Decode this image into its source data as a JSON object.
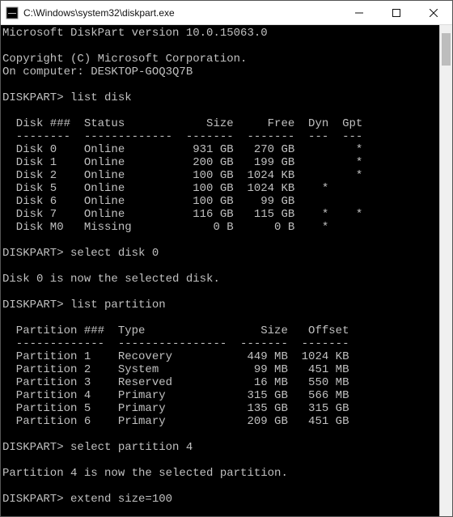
{
  "window": {
    "title": "C:\\Windows\\system32\\diskpart.exe"
  },
  "intro": {
    "version_line": "Microsoft DiskPart version 10.0.15063.0",
    "copyright_line": "Copyright (C) Microsoft Corporation.",
    "computer_line": "On computer: DESKTOP-GOQ3Q7B"
  },
  "prompt": "DISKPART>",
  "commands": {
    "cmd1": "list disk",
    "cmd2": "select disk 0",
    "cmd3": "list partition",
    "cmd4": "select partition 4",
    "cmd5": "extend size=100"
  },
  "messages": {
    "selected_disk": "Disk 0 is now the selected disk.",
    "selected_partition": "Partition 4 is now the selected partition."
  },
  "disk_table": {
    "header": {
      "col1": "Disk ###",
      "col2": "Status",
      "col3": "Size",
      "col4": "Free",
      "col5": "Dyn",
      "col6": "Gpt"
    },
    "rows": [
      {
        "name": "Disk 0",
        "status": "Online",
        "size": "931 GB",
        "free": "270 GB",
        "dyn": "",
        "gpt": "*"
      },
      {
        "name": "Disk 1",
        "status": "Online",
        "size": "200 GB",
        "free": "199 GB",
        "dyn": "",
        "gpt": "*"
      },
      {
        "name": "Disk 2",
        "status": "Online",
        "size": "100 GB",
        "free": "1024 KB",
        "dyn": "",
        "gpt": "*"
      },
      {
        "name": "Disk 5",
        "status": "Online",
        "size": "100 GB",
        "free": "1024 KB",
        "dyn": "*",
        "gpt": ""
      },
      {
        "name": "Disk 6",
        "status": "Online",
        "size": "100 GB",
        "free": "99 GB",
        "dyn": "",
        "gpt": ""
      },
      {
        "name": "Disk 7",
        "status": "Online",
        "size": "116 GB",
        "free": "115 GB",
        "dyn": "*",
        "gpt": "*"
      },
      {
        "name": "Disk M0",
        "status": "Missing",
        "size": "0 B",
        "free": "0 B",
        "dyn": "*",
        "gpt": ""
      }
    ]
  },
  "partition_table": {
    "header": {
      "col1": "Partition ###",
      "col2": "Type",
      "col3": "Size",
      "col4": "Offset"
    },
    "rows": [
      {
        "name": "Partition 1",
        "type": "Recovery",
        "size": "449 MB",
        "offset": "1024 KB"
      },
      {
        "name": "Partition 2",
        "type": "System",
        "size": "99 MB",
        "offset": "451 MB"
      },
      {
        "name": "Partition 3",
        "type": "Reserved",
        "size": "16 MB",
        "offset": "550 MB"
      },
      {
        "name": "Partition 4",
        "type": "Primary",
        "size": "315 GB",
        "offset": "566 MB"
      },
      {
        "name": "Partition 5",
        "type": "Primary",
        "size": "135 GB",
        "offset": "315 GB"
      },
      {
        "name": "Partition 6",
        "type": "Primary",
        "size": "209 GB",
        "offset": "451 GB"
      }
    ]
  }
}
